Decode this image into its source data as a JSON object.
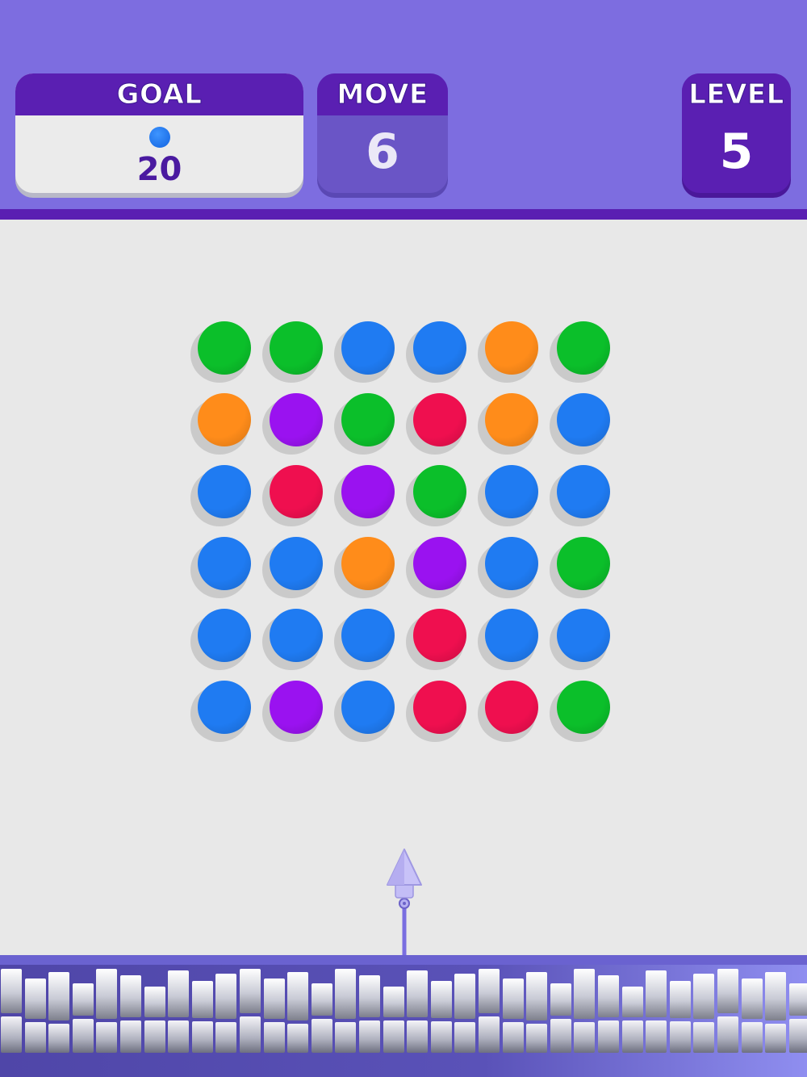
{
  "hud": {
    "goal": {
      "label": "GOAL",
      "target_color": "blue",
      "value": "20"
    },
    "move": {
      "label": "MOVE",
      "value": "6"
    },
    "level": {
      "label": "LEVEL",
      "value": "5"
    }
  },
  "colors": {
    "green": "#0bbf2a",
    "blue": "#1f7bf2",
    "orange": "#ff8c1a",
    "purple": "#9a12f0",
    "red": "#ef0f4f"
  },
  "board": [
    [
      "green",
      "green",
      "blue",
      "blue",
      "orange",
      "green"
    ],
    [
      "orange",
      "purple",
      "green",
      "red",
      "orange",
      "blue"
    ],
    [
      "blue",
      "red",
      "purple",
      "green",
      "blue",
      "blue"
    ],
    [
      "blue",
      "blue",
      "orange",
      "purple",
      "blue",
      "green"
    ],
    [
      "blue",
      "blue",
      "blue",
      "red",
      "blue",
      "blue"
    ],
    [
      "blue",
      "purple",
      "blue",
      "red",
      "red",
      "green"
    ]
  ],
  "shooter": {
    "icon": "arrow-up-icon"
  }
}
